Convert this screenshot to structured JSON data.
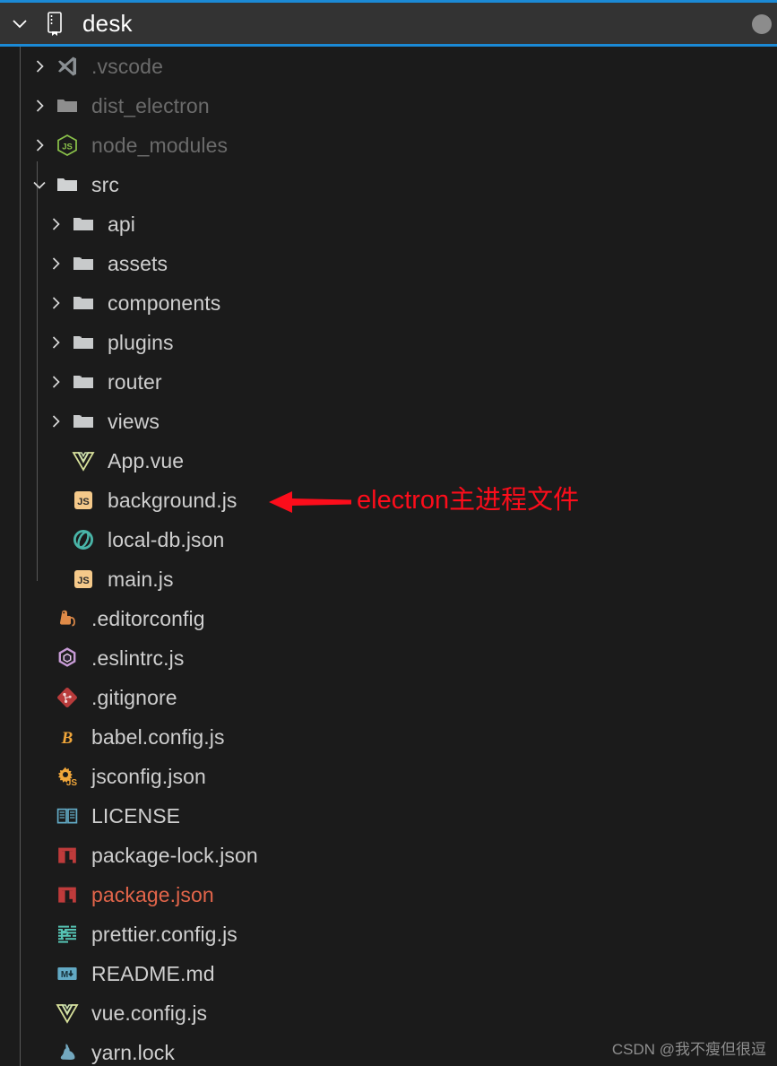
{
  "header": {
    "title": "desk",
    "twisty_icon": "chevron-down-icon",
    "workspace_icon": "workspace-folder-icon",
    "cursor_icon": "cursor-dot"
  },
  "colors": {
    "background": "#1b1b1b",
    "header_background": "#333333",
    "focus_border": "#1b8ad6",
    "text": "#cfcfcf",
    "text_dim": "#6b6b6b",
    "text_modified": "#e2654a",
    "annotation_red": "#fc0d1b",
    "indent_guide": "#585858",
    "watermark": "#8e8e8e"
  },
  "tree": [
    {
      "label": ".vscode",
      "icon": "vscode-icon",
      "twisty": "chevron-right-icon",
      "indent": 1,
      "state": "dim"
    },
    {
      "label": "dist_electron",
      "icon": "folder-icon-dim",
      "twisty": "chevron-right-icon",
      "indent": 1,
      "state": "dim"
    },
    {
      "label": "node_modules",
      "icon": "nodejs-icon",
      "twisty": "chevron-right-icon",
      "indent": 1,
      "state": "dim"
    },
    {
      "label": "src",
      "icon": "folder-icon-open",
      "twisty": "chevron-down-icon",
      "indent": 1,
      "state": "normal"
    },
    {
      "label": "api",
      "icon": "folder-icon",
      "twisty": "chevron-right-icon",
      "indent": 2,
      "state": "normal"
    },
    {
      "label": "assets",
      "icon": "folder-icon",
      "twisty": "chevron-right-icon",
      "indent": 2,
      "state": "normal"
    },
    {
      "label": "components",
      "icon": "folder-icon",
      "twisty": "chevron-right-icon",
      "indent": 2,
      "state": "normal"
    },
    {
      "label": "plugins",
      "icon": "folder-icon",
      "twisty": "chevron-right-icon",
      "indent": 2,
      "state": "normal"
    },
    {
      "label": "router",
      "icon": "folder-icon",
      "twisty": "chevron-right-icon",
      "indent": 2,
      "state": "normal"
    },
    {
      "label": "views",
      "icon": "folder-icon",
      "twisty": "chevron-right-icon",
      "indent": 2,
      "state": "normal"
    },
    {
      "label": "App.vue",
      "icon": "vue-icon",
      "twisty": "none",
      "indent": 2,
      "state": "normal"
    },
    {
      "label": "background.js",
      "icon": "javascript-icon",
      "twisty": "none",
      "indent": 2,
      "state": "normal"
    },
    {
      "label": "local-db.json",
      "icon": "lowdb-icon",
      "twisty": "none",
      "indent": 2,
      "state": "normal"
    },
    {
      "label": "main.js",
      "icon": "javascript-icon",
      "twisty": "none",
      "indent": 2,
      "state": "normal"
    },
    {
      "label": ".editorconfig",
      "icon": "editorconfig-icon",
      "twisty": "none",
      "indent": 1,
      "state": "normal"
    },
    {
      "label": ".eslintrc.js",
      "icon": "eslint-icon",
      "twisty": "none",
      "indent": 1,
      "state": "normal"
    },
    {
      "label": ".gitignore",
      "icon": "git-icon",
      "twisty": "none",
      "indent": 1,
      "state": "normal"
    },
    {
      "label": "babel.config.js",
      "icon": "babel-icon",
      "twisty": "none",
      "indent": 1,
      "state": "normal"
    },
    {
      "label": "jsconfig.json",
      "icon": "jsconfig-icon",
      "twisty": "none",
      "indent": 1,
      "state": "normal"
    },
    {
      "label": "LICENSE",
      "icon": "license-book-icon",
      "twisty": "none",
      "indent": 1,
      "state": "normal"
    },
    {
      "label": "package-lock.json",
      "icon": "npm-icon",
      "twisty": "none",
      "indent": 1,
      "state": "normal"
    },
    {
      "label": "package.json",
      "icon": "npm-icon",
      "twisty": "none",
      "indent": 1,
      "state": "modified"
    },
    {
      "label": "prettier.config.js",
      "icon": "prettier-icon",
      "twisty": "none",
      "indent": 1,
      "state": "normal"
    },
    {
      "label": "README.md",
      "icon": "markdown-icon",
      "twisty": "none",
      "indent": 1,
      "state": "normal"
    },
    {
      "label": "vue.config.js",
      "icon": "vue-icon",
      "twisty": "none",
      "indent": 1,
      "state": "normal"
    },
    {
      "label": "yarn.lock",
      "icon": "yarn-icon",
      "twisty": "none",
      "indent": 1,
      "state": "normal"
    }
  ],
  "annotation": {
    "text": "electron主进程文件",
    "arrow_icon": "left-arrow-icon",
    "points_at": "background.js"
  },
  "watermark": {
    "text": "CSDN @我不瘦但很逗"
  }
}
